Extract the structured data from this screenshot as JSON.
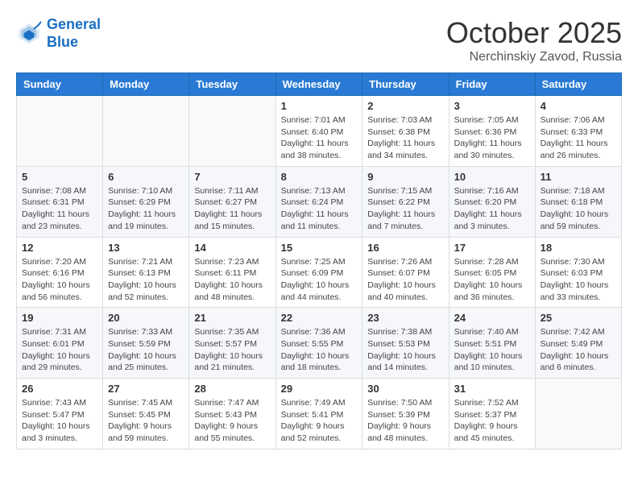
{
  "logo": {
    "line1": "General",
    "line2": "Blue"
  },
  "header": {
    "month": "October 2025",
    "location": "Nerchinskiy Zavod, Russia"
  },
  "weekdays": [
    "Sunday",
    "Monday",
    "Tuesday",
    "Wednesday",
    "Thursday",
    "Friday",
    "Saturday"
  ],
  "weeks": [
    [
      {
        "day": "",
        "info": ""
      },
      {
        "day": "",
        "info": ""
      },
      {
        "day": "",
        "info": ""
      },
      {
        "day": "1",
        "info": "Sunrise: 7:01 AM\nSunset: 6:40 PM\nDaylight: 11 hours\nand 38 minutes."
      },
      {
        "day": "2",
        "info": "Sunrise: 7:03 AM\nSunset: 6:38 PM\nDaylight: 11 hours\nand 34 minutes."
      },
      {
        "day": "3",
        "info": "Sunrise: 7:05 AM\nSunset: 6:36 PM\nDaylight: 11 hours\nand 30 minutes."
      },
      {
        "day": "4",
        "info": "Sunrise: 7:06 AM\nSunset: 6:33 PM\nDaylight: 11 hours\nand 26 minutes."
      }
    ],
    [
      {
        "day": "5",
        "info": "Sunrise: 7:08 AM\nSunset: 6:31 PM\nDaylight: 11 hours\nand 23 minutes."
      },
      {
        "day": "6",
        "info": "Sunrise: 7:10 AM\nSunset: 6:29 PM\nDaylight: 11 hours\nand 19 minutes."
      },
      {
        "day": "7",
        "info": "Sunrise: 7:11 AM\nSunset: 6:27 PM\nDaylight: 11 hours\nand 15 minutes."
      },
      {
        "day": "8",
        "info": "Sunrise: 7:13 AM\nSunset: 6:24 PM\nDaylight: 11 hours\nand 11 minutes."
      },
      {
        "day": "9",
        "info": "Sunrise: 7:15 AM\nSunset: 6:22 PM\nDaylight: 11 hours\nand 7 minutes."
      },
      {
        "day": "10",
        "info": "Sunrise: 7:16 AM\nSunset: 6:20 PM\nDaylight: 11 hours\nand 3 minutes."
      },
      {
        "day": "11",
        "info": "Sunrise: 7:18 AM\nSunset: 6:18 PM\nDaylight: 10 hours\nand 59 minutes."
      }
    ],
    [
      {
        "day": "12",
        "info": "Sunrise: 7:20 AM\nSunset: 6:16 PM\nDaylight: 10 hours\nand 56 minutes."
      },
      {
        "day": "13",
        "info": "Sunrise: 7:21 AM\nSunset: 6:13 PM\nDaylight: 10 hours\nand 52 minutes."
      },
      {
        "day": "14",
        "info": "Sunrise: 7:23 AM\nSunset: 6:11 PM\nDaylight: 10 hours\nand 48 minutes."
      },
      {
        "day": "15",
        "info": "Sunrise: 7:25 AM\nSunset: 6:09 PM\nDaylight: 10 hours\nand 44 minutes."
      },
      {
        "day": "16",
        "info": "Sunrise: 7:26 AM\nSunset: 6:07 PM\nDaylight: 10 hours\nand 40 minutes."
      },
      {
        "day": "17",
        "info": "Sunrise: 7:28 AM\nSunset: 6:05 PM\nDaylight: 10 hours\nand 36 minutes."
      },
      {
        "day": "18",
        "info": "Sunrise: 7:30 AM\nSunset: 6:03 PM\nDaylight: 10 hours\nand 33 minutes."
      }
    ],
    [
      {
        "day": "19",
        "info": "Sunrise: 7:31 AM\nSunset: 6:01 PM\nDaylight: 10 hours\nand 29 minutes."
      },
      {
        "day": "20",
        "info": "Sunrise: 7:33 AM\nSunset: 5:59 PM\nDaylight: 10 hours\nand 25 minutes."
      },
      {
        "day": "21",
        "info": "Sunrise: 7:35 AM\nSunset: 5:57 PM\nDaylight: 10 hours\nand 21 minutes."
      },
      {
        "day": "22",
        "info": "Sunrise: 7:36 AM\nSunset: 5:55 PM\nDaylight: 10 hours\nand 18 minutes."
      },
      {
        "day": "23",
        "info": "Sunrise: 7:38 AM\nSunset: 5:53 PM\nDaylight: 10 hours\nand 14 minutes."
      },
      {
        "day": "24",
        "info": "Sunrise: 7:40 AM\nSunset: 5:51 PM\nDaylight: 10 hours\nand 10 minutes."
      },
      {
        "day": "25",
        "info": "Sunrise: 7:42 AM\nSunset: 5:49 PM\nDaylight: 10 hours\nand 6 minutes."
      }
    ],
    [
      {
        "day": "26",
        "info": "Sunrise: 7:43 AM\nSunset: 5:47 PM\nDaylight: 10 hours\nand 3 minutes."
      },
      {
        "day": "27",
        "info": "Sunrise: 7:45 AM\nSunset: 5:45 PM\nDaylight: 9 hours\nand 59 minutes."
      },
      {
        "day": "28",
        "info": "Sunrise: 7:47 AM\nSunset: 5:43 PM\nDaylight: 9 hours\nand 55 minutes."
      },
      {
        "day": "29",
        "info": "Sunrise: 7:49 AM\nSunset: 5:41 PM\nDaylight: 9 hours\nand 52 minutes."
      },
      {
        "day": "30",
        "info": "Sunrise: 7:50 AM\nSunset: 5:39 PM\nDaylight: 9 hours\nand 48 minutes."
      },
      {
        "day": "31",
        "info": "Sunrise: 7:52 AM\nSunset: 5:37 PM\nDaylight: 9 hours\nand 45 minutes."
      },
      {
        "day": "",
        "info": ""
      }
    ]
  ]
}
